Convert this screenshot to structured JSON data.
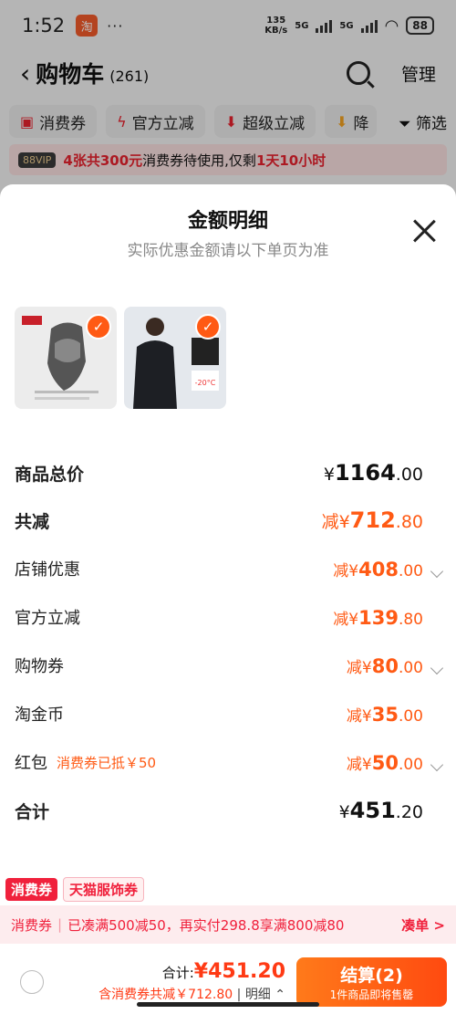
{
  "status": {
    "time": "1:52",
    "dots": "···",
    "net_speed_top": "135",
    "net_speed_bottom": "KB/s",
    "sig1": "5G",
    "sig2": "5G",
    "battery": "88"
  },
  "nav": {
    "title": "购物车",
    "count": "(261)",
    "manage": "管理"
  },
  "filters": [
    {
      "label": "消费券",
      "icon": "coupon-icon"
    },
    {
      "label": "官方立减",
      "icon": "lightning-icon"
    },
    {
      "label": "超级立减",
      "icon": "down-arrow-icon"
    },
    {
      "label": "降",
      "icon": "down-arrow-icon"
    }
  ],
  "filter_btn": "筛选",
  "banner": {
    "vip": "88VIP",
    "highlight": "4张共300元",
    "text": "消费券待使用,仅剩",
    "time": "1天10小时"
  },
  "sheet": {
    "title": "金额明细",
    "subtitle": "实际优惠金额请以下单页为准",
    "rows": [
      {
        "label": "商品总价",
        "prefix": "¥",
        "big": "1164",
        "cents": ".00"
      },
      {
        "label": "共减",
        "prefix": "减¥",
        "big": "712",
        "cents": ".80"
      },
      {
        "label": "店铺优惠",
        "prefix": "减¥",
        "big": "408",
        "cents": ".00"
      },
      {
        "label": "官方立减",
        "prefix": "减¥",
        "big": "139",
        "cents": ".80"
      },
      {
        "label": "购物券",
        "prefix": "减¥",
        "big": "80",
        "cents": ".00"
      },
      {
        "label": "淘金币",
        "prefix": "减¥",
        "big": "35",
        "cents": ".00"
      },
      {
        "label": "红包",
        "note": "消费券已抵￥50",
        "prefix": "减¥",
        "big": "50",
        "cents": ".00"
      },
      {
        "label": "合计",
        "prefix": "¥",
        "big": "451",
        "cents": ".20"
      }
    ]
  },
  "tabs": {
    "t1": "消费券",
    "t2": "天猫服饰券"
  },
  "promo": {
    "label": "消费券",
    "text": "已凑满500减50，再实付298.8享满800减80",
    "go": "凑单 >"
  },
  "checkout": {
    "total_label": "合计:",
    "total_price": "¥451.20",
    "saved": "含消费券共减￥712.80",
    "detail": "明细 ⌃",
    "pay_label": "结算(2)",
    "pay_sub": "1件商品即将售罄"
  },
  "colors": {
    "accent": "#ff5a14",
    "red": "#f0213c"
  }
}
